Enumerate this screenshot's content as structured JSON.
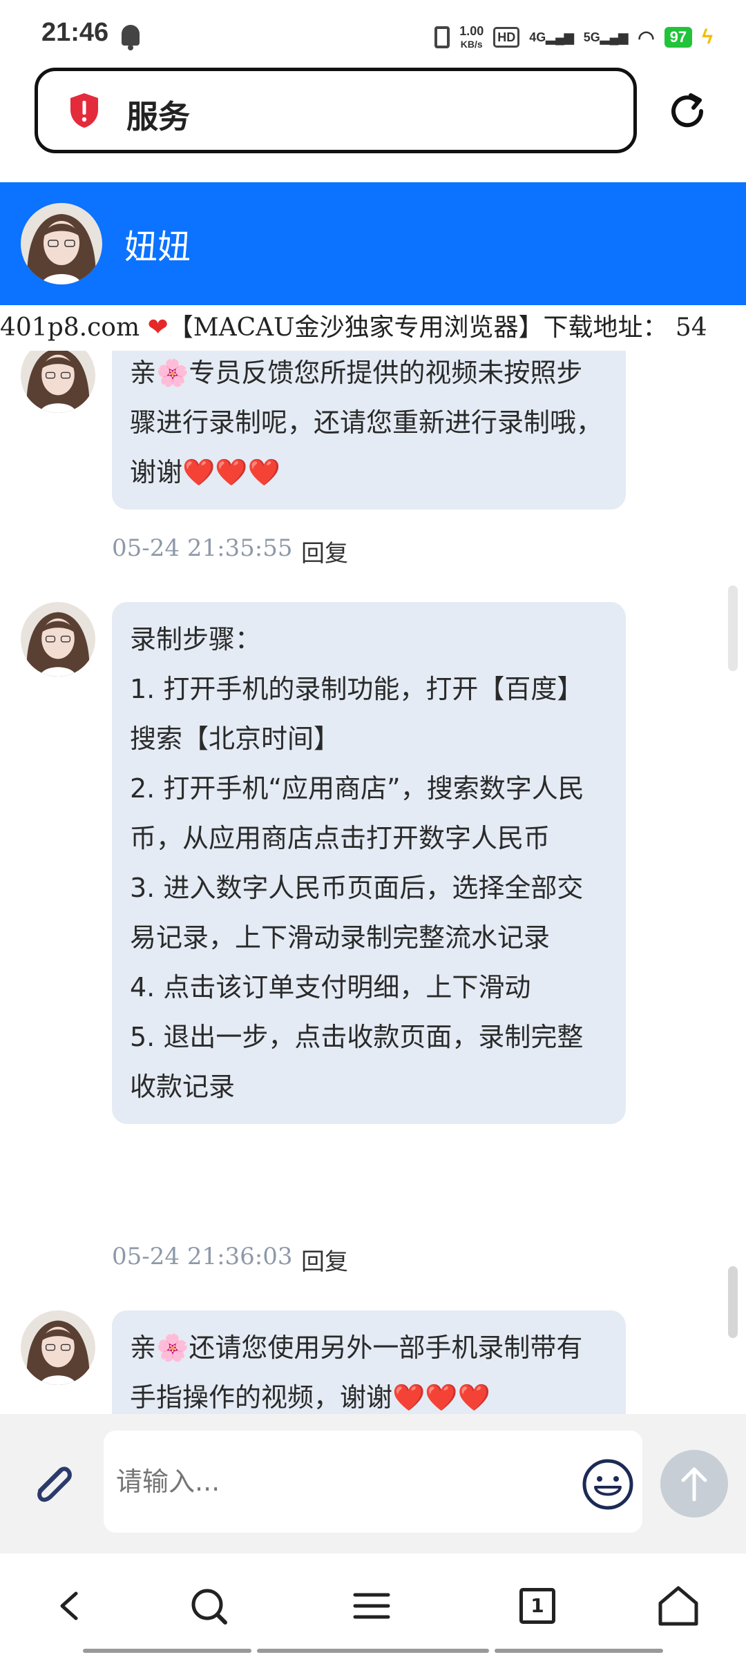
{
  "status_bar": {
    "time": "21:46",
    "net_speed_value": "1.00",
    "net_speed_unit": "KB/s",
    "hd": "HD",
    "signal_4g": "4G",
    "signal_5g": "5G",
    "battery": "97"
  },
  "address_bar": {
    "title": "服务"
  },
  "chat_header": {
    "contact_name": "妞妞"
  },
  "announcement": {
    "text_before": "401p8.com ",
    "text_after": "【MACAU金沙独家专用浏览器】下载地址： 54"
  },
  "messages": [
    {
      "text": "亲🌸专员反馈您所提供的视频未按照步骤进行录制呢，还请您重新进行录制哦，谢谢❤️❤️❤️",
      "timestamp": "05-24 21:35:55",
      "reply_label": "回复"
    },
    {
      "text": "录制步骤：\n1. 打开手机的录制功能，打开【百度】搜索【北京时间】\n2. 打开手机“应用商店”，搜索数字人民币，从应用商店点击打开数字人民币\n3. 进入数字人民币页面后，选择全部交易记录，上下滑动录制完整流水记录\n4. 点击该订单支付明细，上下滑动\n5. 退出一步，点击收款页面，录制完整收款记录",
      "timestamp": "05-24 21:36:03",
      "reply_label": "回复"
    },
    {
      "text": "亲🌸还请您使用另外一部手机录制带有手指操作的视频，谢谢❤️❤️❤️",
      "timestamp": "",
      "reply_label": ""
    }
  ],
  "composer": {
    "placeholder": "请输入..."
  },
  "browser_nav": {
    "tab_count": "1"
  },
  "colors": {
    "header_blue": "#0b73ff",
    "bubble_bg": "#e4ebf4",
    "battery_green": "#22c33a",
    "heart_red": "#e52929"
  }
}
